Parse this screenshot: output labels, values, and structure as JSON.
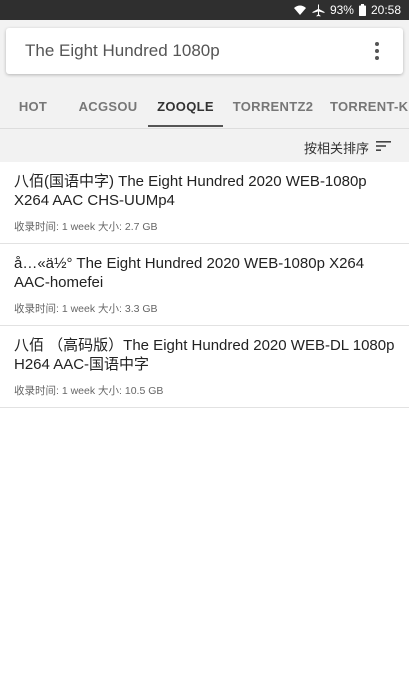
{
  "status_bar": {
    "battery": "93%",
    "time": "20:58",
    "icons": [
      "wifi-icon",
      "airplane-icon",
      "battery-icon"
    ]
  },
  "search": {
    "query": "The Eight Hundred 1080p",
    "menu_icon": "more-vert-icon"
  },
  "tabs": [
    {
      "label": "HOT"
    },
    {
      "label": "ACGSOU"
    },
    {
      "label": "ZOOQLE",
      "active": true
    },
    {
      "label": "TORRENTZ2"
    },
    {
      "label": "TORRENT-KI"
    }
  ],
  "sort": {
    "label": "按相关排序",
    "icon": "sort-icon"
  },
  "results": [
    {
      "title": "八佰(国语中字) The Eight Hundred 2020 WEB-1080p X264 AAC CHS-UUMp4",
      "meta": "收录时间: 1 week 大小: 2.7 GB"
    },
    {
      "title": "å…«ä½° The Eight Hundred 2020 WEB-1080p X264 AAC-homefei",
      "meta": "收录时间: 1 week 大小: 3.3 GB"
    },
    {
      "title": "八佰 （高码版）The Eight Hundred 2020 WEB-DL 1080p H264 AAC-国语中字",
      "meta": "收录时间: 1 week 大小: 10.5 GB"
    }
  ],
  "colors": {
    "status_bar": "#2f2f2f",
    "header_bg": "#f2f2f2",
    "indicator": "#555555"
  }
}
